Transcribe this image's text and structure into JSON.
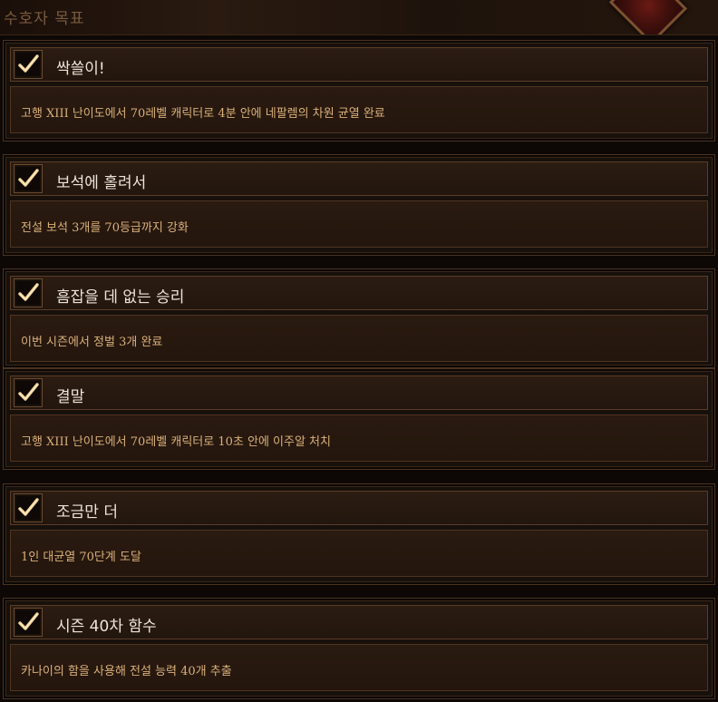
{
  "header": {
    "title": "수호자 목표"
  },
  "colors": {
    "title_text": "#ece4d6",
    "desc_text": "#d9b07a",
    "check_mark": "#e8c88a"
  },
  "objectives": [
    {
      "title": "싹쓸이!",
      "description": "고행 XIII 난이도에서 70레벨 캐릭터로 4분 안에 네팔렘의 차원 균열 완료",
      "completed": true
    },
    {
      "title": "보석에 홀려서",
      "description": "전설 보석 3개를 70등급까지 강화",
      "completed": true
    },
    {
      "title": "흠잡을 데 없는 승리",
      "description": "이번 시즌에서 정벌 3개 완료",
      "completed": true
    },
    {
      "title": "결말",
      "description": "고행 XIII 난이도에서 70레벨 캐릭터로 10초 안에 이주알 처치",
      "completed": true
    },
    {
      "title": "조금만 더",
      "description": "1인 대균열 70단계 도달",
      "completed": true
    },
    {
      "title": "시즌 40차 함수",
      "description": "카나이의 함을 사용해 전설 능력 40개 추출",
      "completed": true
    }
  ]
}
